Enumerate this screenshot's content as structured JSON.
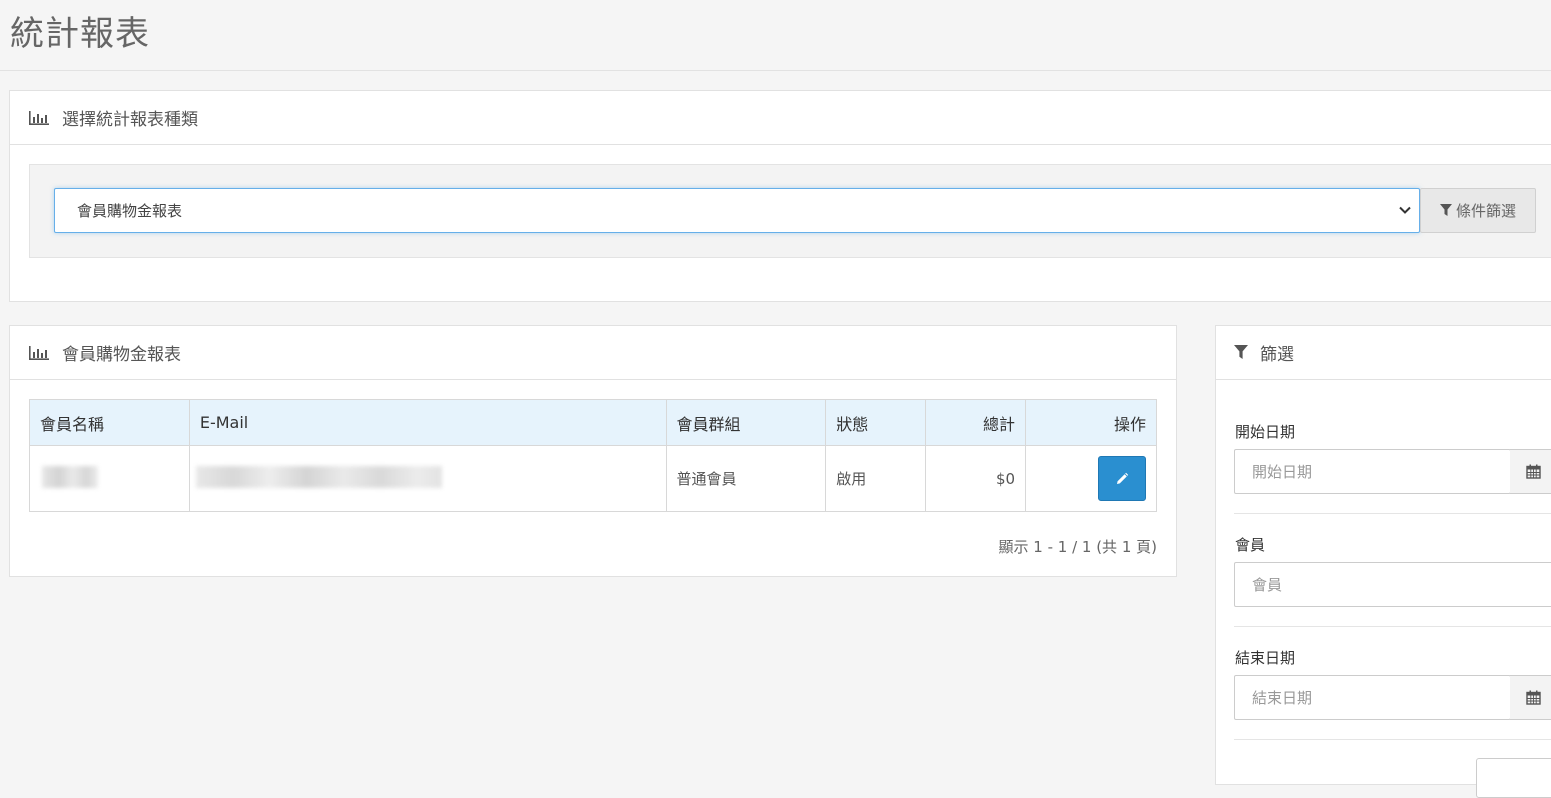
{
  "page": {
    "title": "統計報表"
  },
  "report_type_panel": {
    "title": "選擇統計報表種類",
    "selected_report": "會員購物金報表",
    "filter_button_label": "條件篩選"
  },
  "report_panel": {
    "title": "會員購物金報表",
    "columns": {
      "name": "會員名稱",
      "email": "E-Mail",
      "group": "會員群組",
      "status": "狀態",
      "total": "總計",
      "action": "操作"
    },
    "rows": [
      {
        "group": "普通會員",
        "status": "啟用",
        "total": "$0"
      }
    ],
    "pagination": "顯示 1 - 1 / 1 (共 1 頁)"
  },
  "filter_panel": {
    "title": "篩選",
    "start_date": {
      "label": "開始日期",
      "placeholder": "開始日期"
    },
    "member": {
      "label": "會員",
      "placeholder": "會員"
    },
    "end_date": {
      "label": "結束日期",
      "placeholder": "結束日期"
    }
  },
  "colors": {
    "primary": "#2a8fd0",
    "table_header_bg": "#e6f3fc",
    "page_bg": "#f5f5f5"
  },
  "icons": [
    "bar-chart-icon",
    "filter-icon",
    "chevron-down-icon",
    "pencil-icon",
    "calendar-icon"
  ]
}
